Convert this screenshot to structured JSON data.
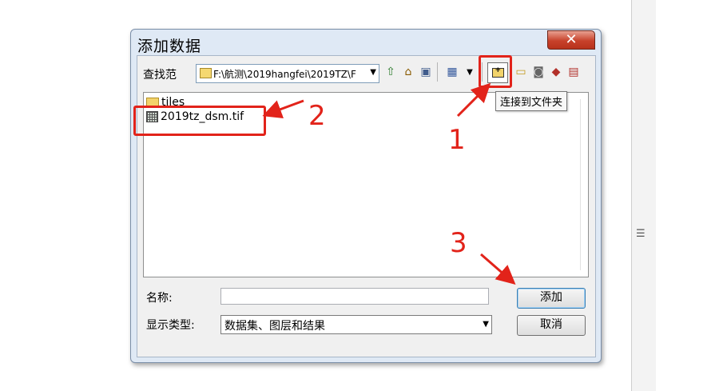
{
  "dialog": {
    "title": "添加数据",
    "close_label": "✕",
    "look_in_label": "查找范",
    "path_value": "F:\\航测\\2019hangfei\\2019TZ\\F",
    "tooltip": "连接到文件夹"
  },
  "toolbar": {
    "icons": [
      "up-folder-icon",
      "home-icon",
      "catalog-icon",
      "view-list-icon",
      "dropdown-icon",
      "connect-folder-icon",
      "new-folder-icon",
      "database-icon",
      "toolbox-icon",
      "table-icon"
    ]
  },
  "files": [
    {
      "name": "tiles",
      "icon": "folder-icon"
    },
    {
      "name": "2019tz_dsm.tif",
      "icon": "raster-icon"
    }
  ],
  "form": {
    "name_label": "名称:",
    "name_value": "",
    "type_label": "显示类型:",
    "type_value": "数据集、图层和结果",
    "add_button": "添加",
    "cancel_button": "取消"
  },
  "annotations": {
    "step1": "1",
    "step2": "2",
    "step3": "3",
    "color": "#e2231a"
  },
  "side_panel": {
    "grip": "☰"
  }
}
